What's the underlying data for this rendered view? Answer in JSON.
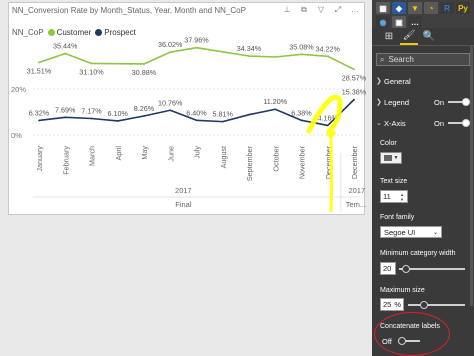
{
  "visual": {
    "title": "NN_Conversion Rate by Month_Status, Year, Month and NN_CoP",
    "toolbar": [
      {
        "name": "pin-icon",
        "glyph": "⊥"
      },
      {
        "name": "copy-icon",
        "glyph": "⧉"
      },
      {
        "name": "filter-icon",
        "glyph": "▽"
      },
      {
        "name": "expand-icon",
        "glyph": "⤢"
      },
      {
        "name": "more-icon",
        "glyph": "…"
      }
    ],
    "legend": {
      "title": "NN_CoP",
      "items": [
        {
          "label": "Customer",
          "color": "#8dc63f"
        },
        {
          "label": "Prospect",
          "color": "#1f3864"
        }
      ]
    }
  },
  "chart_data": {
    "type": "line",
    "categories": [
      "January",
      "February",
      "March",
      "April",
      "May",
      "June",
      "July",
      "August",
      "September",
      "October",
      "November",
      "December",
      "December"
    ],
    "series": [
      {
        "name": "Customer",
        "color": "#8dc63f",
        "values": [
          31.51,
          35.44,
          31.1,
          null,
          30.88,
          36.02,
          37.96,
          null,
          34.34,
          33.91,
          35.08,
          34.22,
          28.57
        ]
      },
      {
        "name": "Prospect",
        "color": "#1f3864",
        "values": [
          6.32,
          7.69,
          7.17,
          6.1,
          8.26,
          10.76,
          6.4,
          5.81,
          8.84,
          11.2,
          6.38,
          4.16,
          15.38
        ]
      }
    ],
    "data_labels": {
      "Customer": [
        "31.51%",
        "35.44%",
        "31.10%",
        "",
        "30.88%",
        "36.02%",
        "37.96%",
        "",
        "34.34%",
        "",
        "35.08%",
        "34.22%",
        "28.57%"
      ],
      "Prospect": [
        "6.32%",
        "7.69%",
        "7.17%",
        "6.10%",
        "8.26%",
        "10.76%",
        "6.40%",
        "5.81%",
        "",
        "11.20%",
        "6.38%",
        "4.16%",
        "15.38%"
      ]
    },
    "y_ticks": [
      "20%",
      "0%"
    ],
    "ylim": [
      0,
      40
    ],
    "x_groups": [
      {
        "year": "2017",
        "status": "Final",
        "span": 12
      },
      {
        "year": "2017",
        "status": "Tem...",
        "span": 1
      }
    ],
    "grid": true,
    "annotation_color": "#ffff00"
  },
  "pane": {
    "viz_icons": [
      {
        "name": "table-icon",
        "glyph": "▦",
        "bg": "#5a5a5a",
        "color": "#ffffff"
      },
      {
        "name": "filled-map-icon",
        "glyph": "◆",
        "bg": "#2a5a9a",
        "color": "#ffffff"
      },
      {
        "name": "funnel-icon",
        "glyph": "▼",
        "bg": "#5a5a5a",
        "color": "#f2c80f"
      },
      {
        "name": "gauge-icon",
        "glyph": "◔",
        "bg": "#5a5a5a",
        "color": "#f2c80f"
      },
      {
        "name": "r-script-icon",
        "glyph": "R",
        "bg": "#3a3a3a",
        "color": "#2e7ad1"
      },
      {
        "name": "python-icon",
        "glyph": "Py",
        "bg": "#3a3a3a",
        "color": "#f2c80f"
      },
      {
        "name": "globe-icon",
        "glyph": "◉",
        "bg": "#3a3a3a",
        "color": "#5fa8e8"
      },
      {
        "name": "custom-visual-icon",
        "glyph": "▣",
        "bg": "#5a5a5a",
        "color": "#ffffff"
      },
      {
        "name": "more-visuals-icon",
        "glyph": "…",
        "bg": "#3a3a3a",
        "color": "#ffffff"
      }
    ],
    "tabs": [
      {
        "name": "fields-tab",
        "glyph": "⊞"
      },
      {
        "name": "format-tab",
        "glyph": "🖌"
      },
      {
        "name": "analytics-tab",
        "glyph": "🔍"
      }
    ],
    "search_placeholder": "Search",
    "sections": [
      {
        "label": "General",
        "expanded": false
      },
      {
        "label": "Legend",
        "expanded": false,
        "state": "On",
        "toggle_on": true
      },
      {
        "label": "X-Axis",
        "expanded": true,
        "state": "On",
        "toggle_on": true
      }
    ],
    "color_label": "Color",
    "text_size_label": "Text size",
    "text_size_value": "11",
    "font_family_label": "Font family",
    "font_family_value": "Segoe UI",
    "min_category_width_label": "Minimum category width",
    "min_category_width_value": "20",
    "min_category_width_level": 0.05,
    "max_size_label": "Maximum size",
    "max_size_value": "25",
    "max_size_unit": "%",
    "max_size_level": 0.25,
    "concatenate_label": "Concatenate labels",
    "concatenate_state": "Off",
    "annotation_color": "#e0202a"
  }
}
